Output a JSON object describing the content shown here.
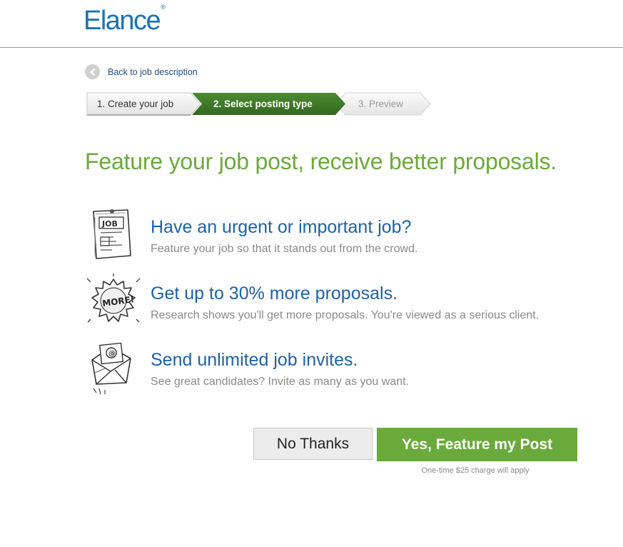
{
  "header": {
    "logo_text": "Elance",
    "logo_mark": "®"
  },
  "nav": {
    "back_label": "Back to job description"
  },
  "steps": [
    {
      "label": "1. Create your job",
      "state": "done"
    },
    {
      "label": "2. Select posting type",
      "state": "active"
    },
    {
      "label": "3. Preview",
      "state": "upcoming"
    }
  ],
  "headline": "Feature your job post, receive better proposals.",
  "features": [
    {
      "icon": "job-sheet-icon",
      "title": "Have an urgent or important job?",
      "desc": "Feature your job so that it stands out from the crowd."
    },
    {
      "icon": "more-badge-icon",
      "title": "Get up to 30% more proposals.",
      "desc": "Research shows you'll get more proposals. You're viewed as a serious client."
    },
    {
      "icon": "envelope-icon",
      "title": "Send unlimited job invites.",
      "desc": "See great candidates? Invite as many as you want."
    }
  ],
  "actions": {
    "no_label": "No Thanks",
    "yes_label": "Yes, Feature my Post",
    "note": "One-time $25 charge will apply"
  },
  "colors": {
    "brand_blue": "#1a73b5",
    "accent_green": "#6aaa3a",
    "step_active": "#3f7b2a"
  }
}
